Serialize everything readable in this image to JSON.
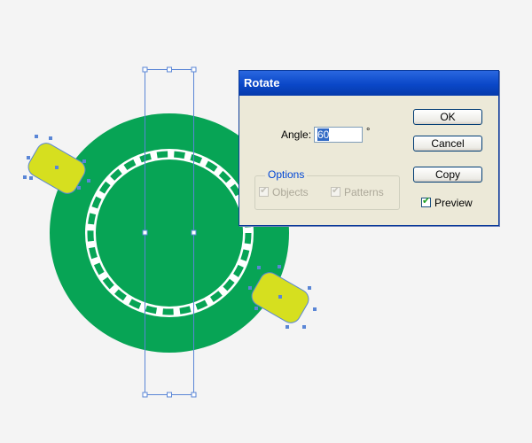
{
  "canvas": {
    "background_color": "#f4f4f4",
    "disc_color": "#07a455",
    "ring_color": "#ffffff",
    "ring_dash_color": "#07a455",
    "shape_fill_color": "#d6df1f",
    "selection_color": "#5a86d6"
  },
  "dialog": {
    "title": "Rotate",
    "angle_label": "Angle:",
    "angle_value": "60",
    "degree_symbol": "°",
    "options_label": "Options",
    "objects_label": "Objects",
    "patterns_label": "Patterns",
    "objects_checked": true,
    "patterns_checked": true,
    "options_disabled": true,
    "ok_label": "OK",
    "cancel_label": "Cancel",
    "copy_label": "Copy",
    "preview_label": "Preview",
    "preview_checked": true
  }
}
